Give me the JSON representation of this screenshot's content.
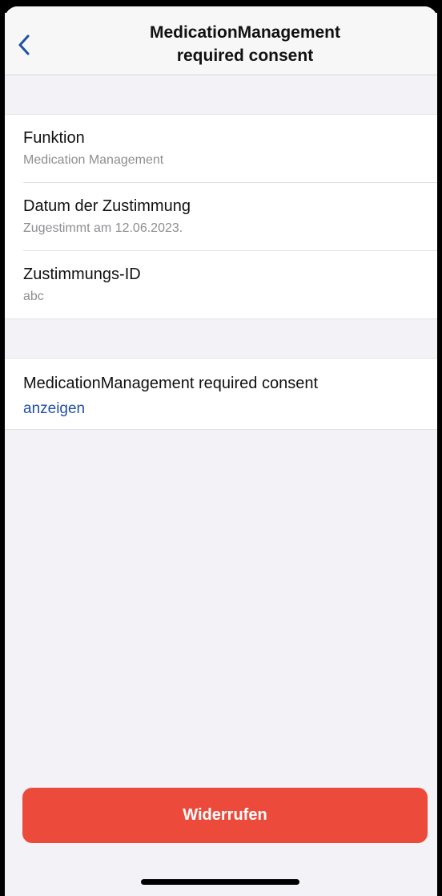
{
  "navbar": {
    "title_line1": "MedicationManagement",
    "title_line2": "required consent",
    "back_icon": "chevron-left-icon",
    "accent_color": "#1f4fa8"
  },
  "details": {
    "items": [
      {
        "label": "Funktion",
        "value": "Medication Management"
      },
      {
        "label": "Datum der Zustimmung",
        "value": "Zugestimmt am 12.06.2023."
      },
      {
        "label": "Zustimmungs-ID",
        "value": "abc"
      }
    ]
  },
  "document": {
    "label": "MedicationManagement required consent",
    "link_label": "anzeigen"
  },
  "actions": {
    "revoke_label": "Widerrufen",
    "revoke_color": "#ec4b3c"
  }
}
